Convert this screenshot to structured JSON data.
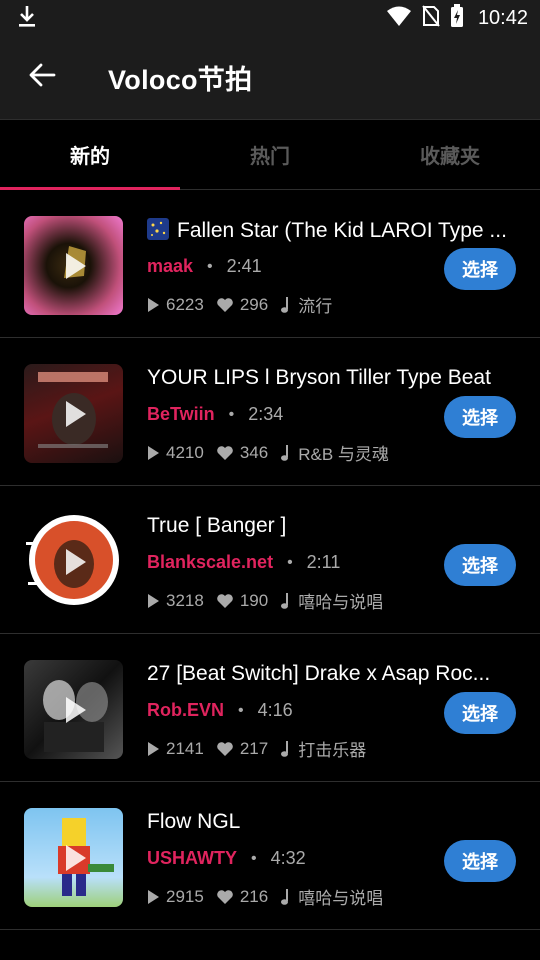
{
  "status": {
    "time": "10:42"
  },
  "header": {
    "title": "Voloco节拍"
  },
  "tabs": [
    {
      "label": "新的"
    },
    {
      "label": "热门"
    },
    {
      "label": "收藏夹"
    }
  ],
  "beats": [
    {
      "title": "Fallen Star (The Kid LAROI Type ...",
      "artist": "maak",
      "duration": "2:41",
      "plays": "6223",
      "likes": "296",
      "genre": "流行",
      "button": "选择"
    },
    {
      "title": "YOUR LIPS l Bryson Tiller Type Beat",
      "artist": "BeTwiin",
      "duration": "2:34",
      "plays": "4210",
      "likes": "346",
      "genre": "R&B 与灵魂",
      "button": "选择"
    },
    {
      "title": "True [ Banger ]",
      "artist": "Blankscale.net",
      "duration": "2:11",
      "plays": "3218",
      "likes": "190",
      "genre": "嘻哈与说唱",
      "button": "选择"
    },
    {
      "title": "27 [Beat Switch] Drake x Asap Roc...",
      "artist": "Rob.EVN",
      "duration": "4:16",
      "plays": "2141",
      "likes": "217",
      "genre": "打击乐器",
      "button": "选择"
    },
    {
      "title": "Flow NGL",
      "artist": "USHAWTY",
      "duration": "4:32",
      "plays": "2915",
      "likes": "216",
      "genre": "嘻哈与说唱",
      "button": "选择"
    }
  ]
}
